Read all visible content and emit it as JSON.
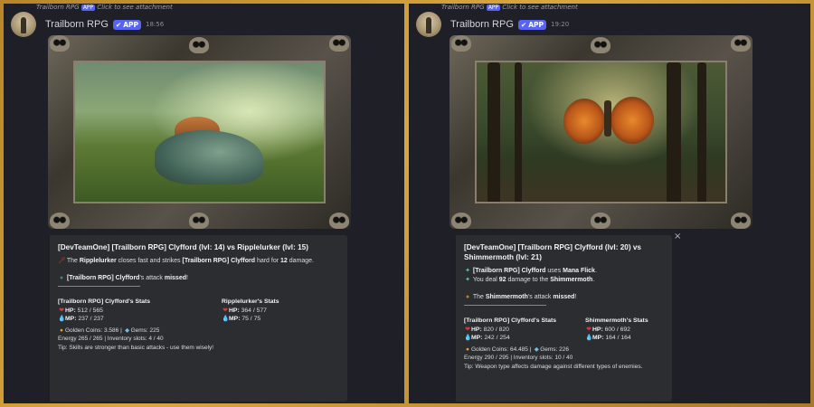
{
  "left": {
    "reply_bar": {
      "app": "APP",
      "text": "Trailborn RPG",
      "click": "Click to see attachment"
    },
    "author": "Trailborn RPG",
    "badge": "APP",
    "time": "18:56",
    "embed": {
      "title": "[DevTeamOne] [Trailborn RPG] Clyfford (lvl: 14) vs Ripplelurker (lvl: 15)",
      "line1_a": "The",
      "line1_b": "Ripplelurker",
      "line1_c": "closes fast and strikes",
      "line1_d": "[Trailborn RPG] Clyfford",
      "line1_e": "hard for",
      "line1_f": "12",
      "line1_g": "damage.",
      "line2_a": "[Trailborn RPG] Clyfford",
      "line2_b": "'s attack",
      "line2_c": "missed",
      "line2_d": "!",
      "rule": "———————————————",
      "player_head": "[Trailborn RPG] Clyfford's Stats",
      "player_hp_label": "HP:",
      "player_hp": "512 / 565",
      "player_mp_label": "MP:",
      "player_mp": "237 / 237",
      "enemy_head": "Ripplelurker's Stats",
      "enemy_hp_label": "HP:",
      "enemy_hp": "364 / 577",
      "enemy_mp_label": "MP:",
      "enemy_mp": "75 / 75",
      "coins": "Golden Coins: 3.586 |",
      "gems": "Gems: 225",
      "energy": "Energy 265 / 265 | Inventory slots: 4 / 40",
      "tip": "Tip: Skills are stronger than basic attacks - use them wisely!"
    }
  },
  "right": {
    "reply_bar": {
      "app": "APP",
      "text": "Trailborn RPG",
      "click": "Click to see attachment"
    },
    "author": "Trailborn RPG",
    "badge": "APP",
    "time": "19:20",
    "close": "×",
    "embed": {
      "title": "[DevTeamOne] [Trailborn RPG] Clyfford (lvl: 20) vs Shimmermoth (lvl: 21)",
      "line1_a": "[Trailborn RPG] Clyfford",
      "line1_b": "uses",
      "line1_c": "Mana Flick",
      "line1_d": ".",
      "line1b_a": "You deal",
      "line1b_b": "92",
      "line1b_c": "damage to the",
      "line1b_d": "Shimmermoth",
      "line1b_e": ".",
      "line2_a": "The",
      "line2_b": "Shimmermoth",
      "line2_c": "'s attack",
      "line2_d": "missed",
      "line2_e": "!",
      "rule": "———————————————",
      "player_head": "[Trailborn RPG] Clyfford's Stats",
      "player_hp_label": "HP:",
      "player_hp": "820 / 820",
      "player_mp_label": "MP:",
      "player_mp": "242 / 254",
      "enemy_head": "Shimmermoth's Stats",
      "enemy_hp_label": "HP:",
      "enemy_hp": "600 / 692",
      "enemy_mp_label": "MP:",
      "enemy_mp": "164 / 164",
      "coins": "Golden Coins: 64.485 |",
      "gems": "Gems: 226",
      "energy": "Energy 290 / 295 | Inventory slots: 10 / 40",
      "tip": "Tip: Weapon type affects damage against different types of enemies."
    }
  }
}
